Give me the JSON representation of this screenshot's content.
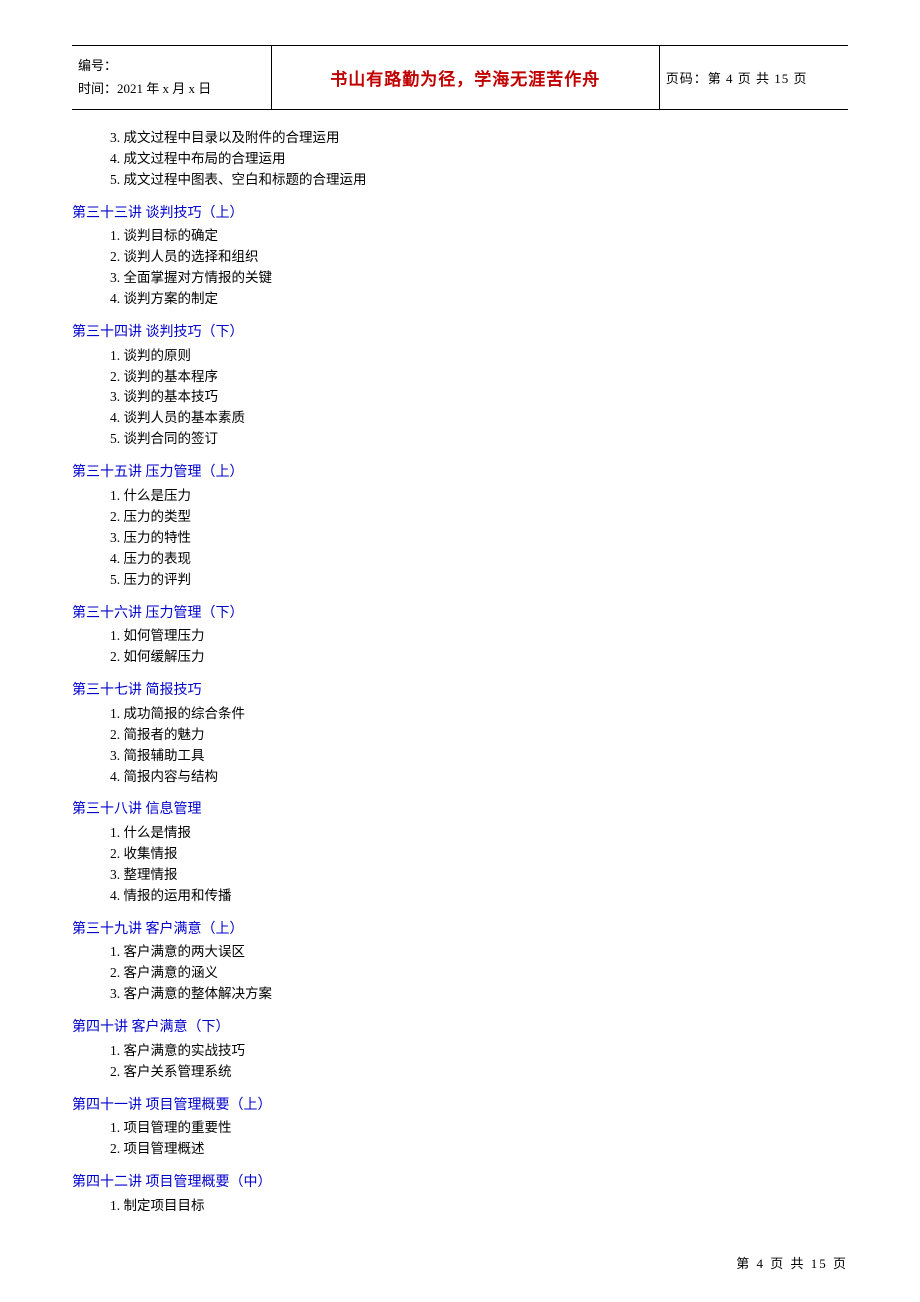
{
  "header": {
    "id_label": "编号：",
    "time_label": "时间：2021 年 x 月 x 日",
    "motto": "书山有路勤为径，学海无涯苦作舟",
    "page_label": "页码：第 4 页  共 15 页"
  },
  "pre_items": [
    "3. 成文过程中目录以及附件的合理运用",
    "4. 成文过程中布局的合理运用",
    "5. 成文过程中图表、空白和标题的合理运用"
  ],
  "sections": [
    {
      "title": "第三十三讲    谈判技巧（上）",
      "items": [
        "1. 谈判目标的确定",
        "2. 谈判人员的选择和组织",
        "3. 全面掌握对方情报的关键",
        "4. 谈判方案的制定"
      ]
    },
    {
      "title": "第三十四讲   谈判技巧（下）",
      "items": [
        "1. 谈判的原则",
        "2. 谈判的基本程序",
        "3. 谈判的基本技巧",
        "4. 谈判人员的基本素质",
        "5. 谈判合同的签订"
      ]
    },
    {
      "title": "第三十五讲   压力管理（上）",
      "items": [
        "1. 什么是压力",
        "2. 压力的类型",
        "3. 压力的特性",
        "4. 压力的表现",
        "5. 压力的评判"
      ]
    },
    {
      "title": "第三十六讲   压力管理（下）",
      "items": [
        "1. 如何管理压力",
        "2. 如何缓解压力"
      ]
    },
    {
      "title": "第三十七讲   简报技巧",
      "items": [
        "1. 成功简报的综合条件",
        "2. 简报者的魅力",
        "3. 简报辅助工具",
        "4. 简报内容与结构"
      ]
    },
    {
      "title": "第三十八讲   信息管理",
      "items": [
        "1. 什么是情报",
        "2. 收集情报",
        "3. 整理情报",
        "4. 情报的运用和传播"
      ]
    },
    {
      "title": "第三十九讲   客户满意（上）",
      "items": [
        "1. 客户满意的两大误区",
        "2. 客户满意的涵义",
        "3. 客户满意的整体解决方案"
      ]
    },
    {
      "title": "第四十讲  客户满意（下）",
      "items": [
        "1. 客户满意的实战技巧",
        "2. 客户关系管理系统"
      ]
    },
    {
      "title": "第四十一讲   项目管理概要（上）",
      "items": [
        "1. 项目管理的重要性",
        "2. 项目管理概述"
      ]
    },
    {
      "title": "第四十二讲   项目管理概要（中）",
      "items": [
        "1. 制定项目目标"
      ]
    }
  ],
  "footer": "第  4  页  共  15  页"
}
